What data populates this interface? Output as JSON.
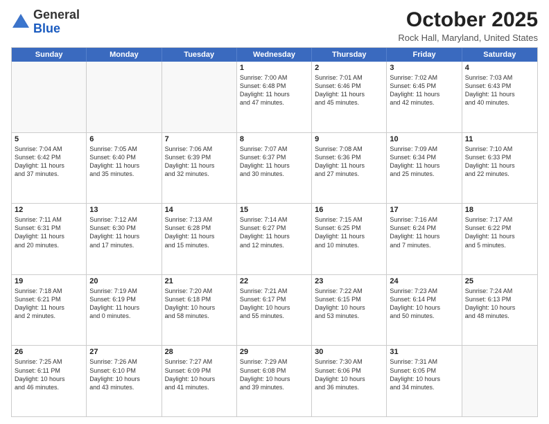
{
  "logo": {
    "general": "General",
    "blue": "Blue"
  },
  "title": "October 2025",
  "location": "Rock Hall, Maryland, United States",
  "dayHeaders": [
    "Sunday",
    "Monday",
    "Tuesday",
    "Wednesday",
    "Thursday",
    "Friday",
    "Saturday"
  ],
  "weeks": [
    [
      {
        "day": "",
        "info": ""
      },
      {
        "day": "",
        "info": ""
      },
      {
        "day": "",
        "info": ""
      },
      {
        "day": "1",
        "info": "Sunrise: 7:00 AM\nSunset: 6:48 PM\nDaylight: 11 hours\nand 47 minutes."
      },
      {
        "day": "2",
        "info": "Sunrise: 7:01 AM\nSunset: 6:46 PM\nDaylight: 11 hours\nand 45 minutes."
      },
      {
        "day": "3",
        "info": "Sunrise: 7:02 AM\nSunset: 6:45 PM\nDaylight: 11 hours\nand 42 minutes."
      },
      {
        "day": "4",
        "info": "Sunrise: 7:03 AM\nSunset: 6:43 PM\nDaylight: 11 hours\nand 40 minutes."
      }
    ],
    [
      {
        "day": "5",
        "info": "Sunrise: 7:04 AM\nSunset: 6:42 PM\nDaylight: 11 hours\nand 37 minutes."
      },
      {
        "day": "6",
        "info": "Sunrise: 7:05 AM\nSunset: 6:40 PM\nDaylight: 11 hours\nand 35 minutes."
      },
      {
        "day": "7",
        "info": "Sunrise: 7:06 AM\nSunset: 6:39 PM\nDaylight: 11 hours\nand 32 minutes."
      },
      {
        "day": "8",
        "info": "Sunrise: 7:07 AM\nSunset: 6:37 PM\nDaylight: 11 hours\nand 30 minutes."
      },
      {
        "day": "9",
        "info": "Sunrise: 7:08 AM\nSunset: 6:36 PM\nDaylight: 11 hours\nand 27 minutes."
      },
      {
        "day": "10",
        "info": "Sunrise: 7:09 AM\nSunset: 6:34 PM\nDaylight: 11 hours\nand 25 minutes."
      },
      {
        "day": "11",
        "info": "Sunrise: 7:10 AM\nSunset: 6:33 PM\nDaylight: 11 hours\nand 22 minutes."
      }
    ],
    [
      {
        "day": "12",
        "info": "Sunrise: 7:11 AM\nSunset: 6:31 PM\nDaylight: 11 hours\nand 20 minutes."
      },
      {
        "day": "13",
        "info": "Sunrise: 7:12 AM\nSunset: 6:30 PM\nDaylight: 11 hours\nand 17 minutes."
      },
      {
        "day": "14",
        "info": "Sunrise: 7:13 AM\nSunset: 6:28 PM\nDaylight: 11 hours\nand 15 minutes."
      },
      {
        "day": "15",
        "info": "Sunrise: 7:14 AM\nSunset: 6:27 PM\nDaylight: 11 hours\nand 12 minutes."
      },
      {
        "day": "16",
        "info": "Sunrise: 7:15 AM\nSunset: 6:25 PM\nDaylight: 11 hours\nand 10 minutes."
      },
      {
        "day": "17",
        "info": "Sunrise: 7:16 AM\nSunset: 6:24 PM\nDaylight: 11 hours\nand 7 minutes."
      },
      {
        "day": "18",
        "info": "Sunrise: 7:17 AM\nSunset: 6:22 PM\nDaylight: 11 hours\nand 5 minutes."
      }
    ],
    [
      {
        "day": "19",
        "info": "Sunrise: 7:18 AM\nSunset: 6:21 PM\nDaylight: 11 hours\nand 2 minutes."
      },
      {
        "day": "20",
        "info": "Sunrise: 7:19 AM\nSunset: 6:19 PM\nDaylight: 11 hours\nand 0 minutes."
      },
      {
        "day": "21",
        "info": "Sunrise: 7:20 AM\nSunset: 6:18 PM\nDaylight: 10 hours\nand 58 minutes."
      },
      {
        "day": "22",
        "info": "Sunrise: 7:21 AM\nSunset: 6:17 PM\nDaylight: 10 hours\nand 55 minutes."
      },
      {
        "day": "23",
        "info": "Sunrise: 7:22 AM\nSunset: 6:15 PM\nDaylight: 10 hours\nand 53 minutes."
      },
      {
        "day": "24",
        "info": "Sunrise: 7:23 AM\nSunset: 6:14 PM\nDaylight: 10 hours\nand 50 minutes."
      },
      {
        "day": "25",
        "info": "Sunrise: 7:24 AM\nSunset: 6:13 PM\nDaylight: 10 hours\nand 48 minutes."
      }
    ],
    [
      {
        "day": "26",
        "info": "Sunrise: 7:25 AM\nSunset: 6:11 PM\nDaylight: 10 hours\nand 46 minutes."
      },
      {
        "day": "27",
        "info": "Sunrise: 7:26 AM\nSunset: 6:10 PM\nDaylight: 10 hours\nand 43 minutes."
      },
      {
        "day": "28",
        "info": "Sunrise: 7:27 AM\nSunset: 6:09 PM\nDaylight: 10 hours\nand 41 minutes."
      },
      {
        "day": "29",
        "info": "Sunrise: 7:29 AM\nSunset: 6:08 PM\nDaylight: 10 hours\nand 39 minutes."
      },
      {
        "day": "30",
        "info": "Sunrise: 7:30 AM\nSunset: 6:06 PM\nDaylight: 10 hours\nand 36 minutes."
      },
      {
        "day": "31",
        "info": "Sunrise: 7:31 AM\nSunset: 6:05 PM\nDaylight: 10 hours\nand 34 minutes."
      },
      {
        "day": "",
        "info": ""
      }
    ]
  ]
}
